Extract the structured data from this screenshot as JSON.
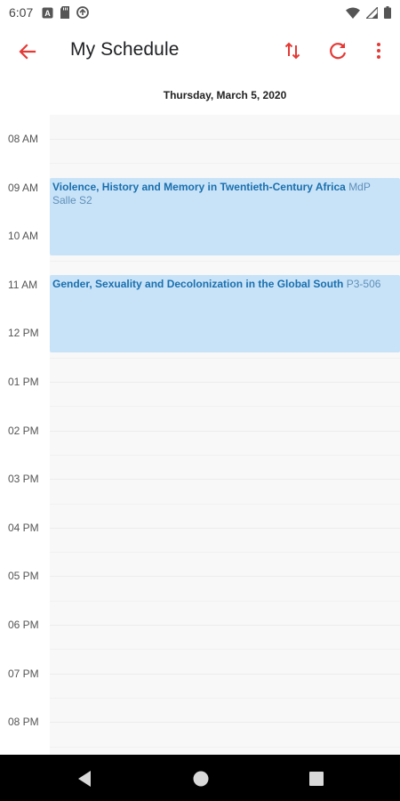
{
  "status_bar": {
    "time": "6:07",
    "left_icons": [
      "notification-a-icon",
      "sd-card-icon",
      "sync-icon"
    ],
    "right_icons": [
      "wifi-icon",
      "cell-signal-icon",
      "battery-icon"
    ]
  },
  "app_bar": {
    "back_icon": "arrow-left-icon",
    "title": "My Schedule",
    "actions": [
      "sort-icon",
      "refresh-icon",
      "more-vert-icon"
    ],
    "accent_color": "#e53935"
  },
  "date": "Thursday, March 5, 2020",
  "time_labels": [
    "08 AM",
    "09 AM",
    "10 AM",
    "11 AM",
    "12 PM",
    "01 PM",
    "02 PM",
    "03 PM",
    "04 PM",
    "05 PM",
    "06 PM",
    "07 PM",
    "08 PM"
  ],
  "events": [
    {
      "title": "Violence, History and Memory in Twentieth-Century Africa",
      "room": "MdP Salle S2",
      "start_hour": 8.8,
      "end_hour": 10.4
    },
    {
      "title": "Gender, Sexuality and Decolonization in the Global South",
      "room": "P3-506",
      "start_hour": 10.8,
      "end_hour": 12.4
    }
  ],
  "event_colors": {
    "background": "#c8e3f8",
    "title": "#1a6fae",
    "room": "#5f8fba"
  },
  "nav_bar": {
    "buttons": [
      "back-triangle-icon",
      "home-circle-icon",
      "recents-square-icon"
    ]
  }
}
